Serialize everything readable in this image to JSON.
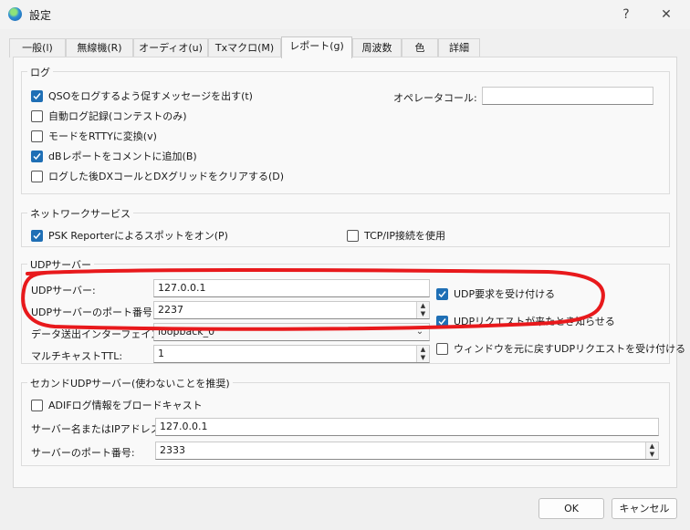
{
  "window": {
    "title": "設定",
    "help_label": "?",
    "close_label": "✕"
  },
  "tabs": [
    {
      "label": "一般(l)"
    },
    {
      "label": "無線機(R)"
    },
    {
      "label": "オーディオ(u)"
    },
    {
      "label": "Txマクロ(M)"
    },
    {
      "label": "レポート(g)"
    },
    {
      "label": "周波数"
    },
    {
      "label": "色"
    },
    {
      "label": "詳細"
    }
  ],
  "log_group": {
    "title": "ログ",
    "prompt_qso": {
      "label": "QSOをログするよう促すメッセージを出す(t)",
      "checked": true
    },
    "auto_log": {
      "label": "自動ログ記録(コンテストのみ)",
      "checked": false
    },
    "mode_rtty": {
      "label": "モードをRTTYに変換(v)",
      "checked": false
    },
    "db_report": {
      "label": "dBレポートをコメントに追加(B)",
      "checked": true
    },
    "clear_dx": {
      "label": "ログした後DXコールとDXグリッドをクリアする(D)",
      "checked": false
    },
    "operator_call_label": "オペレータコール:",
    "operator_call_value": ""
  },
  "network_group": {
    "title": "ネットワークサービス",
    "psk": {
      "label": "PSK Reporterによるスポットをオン(P)",
      "checked": true
    },
    "tcpip": {
      "label": "TCP/IP接続を使用",
      "checked": false
    }
  },
  "udp_group": {
    "title": "UDPサーバー",
    "server_label": "UDPサーバー:",
    "server_value": "127.0.0.1",
    "port_label": "UDPサーバーのポート番号:",
    "port_value": "2237",
    "iface_label": "データ送出インターフェイス:",
    "iface_value": "loopback_0",
    "ttl_label": "マルチキャストTTL:",
    "ttl_value": "1",
    "accept_udp": {
      "label": "UDP要求を受け付ける",
      "checked": true
    },
    "notify_udp": {
      "label": "UDPリクエストが来たとき知らせる",
      "checked": true
    },
    "restore_window": {
      "label": "ウィンドウを元に戻すUDPリクエストを受け付ける",
      "checked": false
    }
  },
  "secondary_group": {
    "title": "セカンドUDPサーバー(使わないことを推奨)",
    "adif": {
      "label": "ADIFログ情報をブロードキャスト",
      "checked": false
    },
    "server_label": "サーバー名またはIPアドレス:",
    "server_value": "127.0.0.1",
    "port_label": "サーバーのポート番号:",
    "port_value": "2333"
  },
  "buttons": {
    "ok": "OK",
    "cancel": "キャンセル"
  },
  "colors": {
    "accent": "#1f6fb5",
    "annotation": "#e8191c"
  }
}
